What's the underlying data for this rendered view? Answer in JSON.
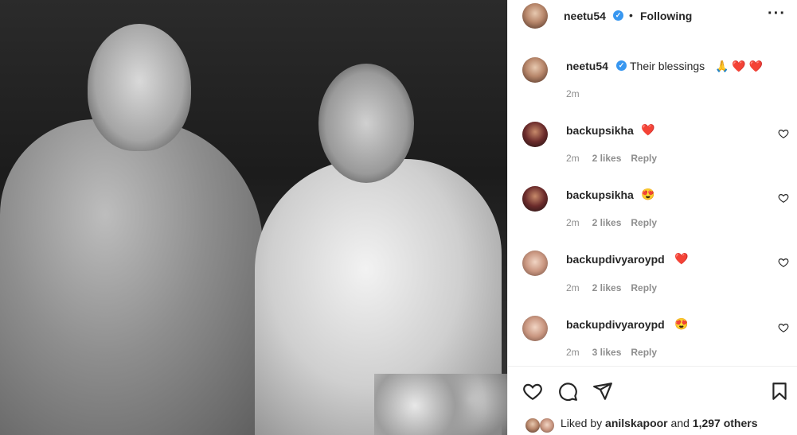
{
  "post": {
    "username": "neetu54",
    "follow_status": "Following",
    "caption_text": "Their blessings",
    "caption_emojis": "🙏 ❤️ ❤️",
    "caption_time": "2m"
  },
  "comments": [
    {
      "username": "backupsikha",
      "emoji": "❤️",
      "time": "2m",
      "likes": "2 likes",
      "reply": "Reply"
    },
    {
      "username": "backupsikha",
      "emoji": "😍",
      "time": "2m",
      "likes": "2 likes",
      "reply": "Reply"
    },
    {
      "username": "backupdivyaroypd",
      "emoji": "❤️",
      "time": "2m",
      "likes": "2 likes",
      "reply": "Reply"
    },
    {
      "username": "backupdivyaroypd",
      "emoji": "😍",
      "time": "2m",
      "likes": "3 likes",
      "reply": "Reply"
    }
  ],
  "likes": {
    "prefix": "Liked by",
    "user": "anilskapoor",
    "conjunction": "and",
    "others": "1,297 others"
  },
  "icons": {
    "verified": "verified-badge-icon",
    "more": "more-options-icon",
    "like": "heart-icon",
    "comment": "comment-icon",
    "share": "share-icon",
    "save": "bookmark-icon"
  },
  "colors": {
    "verified": "#3897f0",
    "heart": "#ed4956",
    "meta": "#8e8e8e",
    "text": "#262626"
  }
}
